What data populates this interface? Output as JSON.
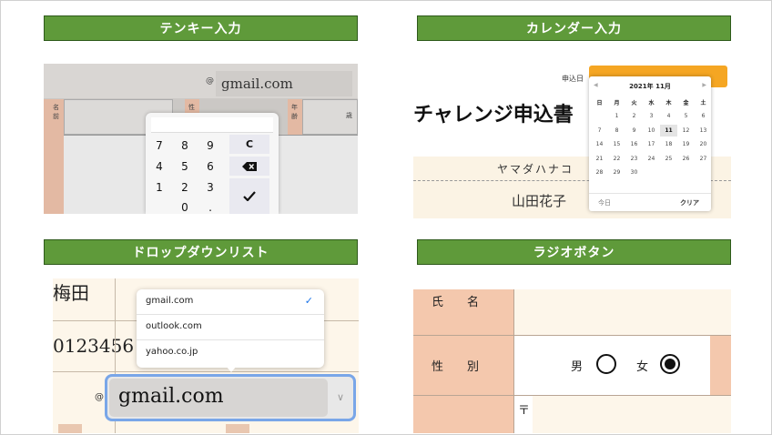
{
  "headers": {
    "keypad": "テンキー入力",
    "calendar": "カレンダー入力",
    "dropdown": "ドロップダウンリスト",
    "radio": "ラジオボタン"
  },
  "keypad_panel": {
    "at_sign": "@",
    "email_value": "gmail.com",
    "labels": {
      "name": "名前",
      "sex": "性",
      "age": "年齢",
      "years": "歳"
    },
    "keys": [
      "7",
      "8",
      "9",
      "4",
      "5",
      "6",
      "1",
      "2",
      "3",
      "0",
      "."
    ],
    "clear_key": "C",
    "backspace_icon": "backspace-icon",
    "enter_icon": "checkmark-icon"
  },
  "calendar_panel": {
    "apply_date_label": "申込日",
    "title": "チャレンジ申込書",
    "kana": "ヤマダハナコ",
    "name": "山田花子",
    "month_label": "2021年 11月",
    "weekdays": [
      "日",
      "月",
      "火",
      "水",
      "木",
      "金",
      "土"
    ],
    "weeks": [
      [
        "",
        "1",
        "2",
        "3",
        "4",
        "5",
        "6"
      ],
      [
        "7",
        "8",
        "9",
        "10",
        "11",
        "12",
        "13"
      ],
      [
        "14",
        "15",
        "16",
        "17",
        "18",
        "19",
        "20"
      ],
      [
        "21",
        "22",
        "23",
        "24",
        "25",
        "26",
        "27"
      ],
      [
        "28",
        "29",
        "30",
        "",
        "",
        "",
        ""
      ]
    ],
    "selected_day": "11",
    "today_label": "今日",
    "clear_label": "クリア"
  },
  "dropdown_panel": {
    "left_top_text": "梅田",
    "left_mid_text": "0123456",
    "options": [
      "gmail.com",
      "outlook.com",
      "yahoo.co.jp"
    ],
    "selected_option": "gmail.com",
    "at_sign": "@",
    "select_value": "gmail.com"
  },
  "radio_panel": {
    "name_label": "氏　　名",
    "sex_label": "性　　別",
    "male": "男",
    "female": "女",
    "selected": "女",
    "postal_mark": "〒"
  }
}
